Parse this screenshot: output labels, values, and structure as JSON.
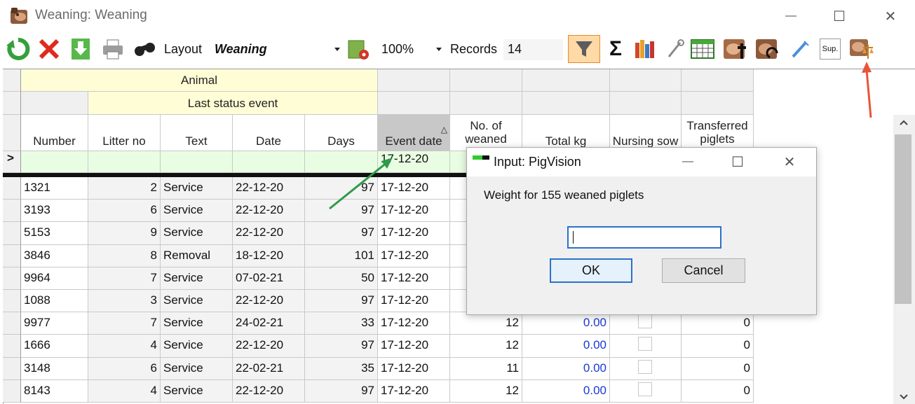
{
  "window": {
    "title": "Weaning: Weaning",
    "minimize_glyph": "—",
    "maximize_glyph": "☐",
    "close_glyph": "✕"
  },
  "toolbar": {
    "layout_label": "Layout",
    "layout_value": "Weaning",
    "zoom_value": "100%",
    "records_label": "Records",
    "records_value": "14",
    "sigma": "Σ",
    "sup_label": "Sup."
  },
  "grid": {
    "group_headers": {
      "animal": "Animal",
      "last_status_event": "Last status event"
    },
    "columns": {
      "number": "Number",
      "litter_no": "Litter no",
      "text": "Text",
      "date": "Date",
      "days": "Days",
      "event_date": "Event date",
      "no_of_weaned": "No. of weaned",
      "total_kg": "Total kg",
      "nursing_sow": "Nursing sow",
      "transferred_piglets": "Transferred piglets"
    },
    "sort_indicator": "△",
    "current_row_marker": ">",
    "new_row": {
      "event_date": "17-12-20"
    },
    "rows": [
      {
        "number": "1321",
        "litter": "2",
        "text": "Service",
        "date": "22-12-20",
        "days": "97",
        "event_date": "17-12-20",
        "weaned": "",
        "kg": "",
        "transferred": ""
      },
      {
        "number": "3193",
        "litter": "6",
        "text": "Service",
        "date": "22-12-20",
        "days": "97",
        "event_date": "17-12-20",
        "weaned": "",
        "kg": "",
        "transferred": ""
      },
      {
        "number": "5153",
        "litter": "9",
        "text": "Service",
        "date": "22-12-20",
        "days": "97",
        "event_date": "17-12-20",
        "weaned": "",
        "kg": "",
        "transferred": ""
      },
      {
        "number": "3846",
        "litter": "8",
        "text": "Removal",
        "date": "18-12-20",
        "days": "101",
        "event_date": "17-12-20",
        "weaned": "",
        "kg": "",
        "transferred": ""
      },
      {
        "number": "9964",
        "litter": "7",
        "text": "Service",
        "date": "07-02-21",
        "days": "50",
        "event_date": "17-12-20",
        "weaned": "",
        "kg": "",
        "transferred": ""
      },
      {
        "number": "1088",
        "litter": "3",
        "text": "Service",
        "date": "22-12-20",
        "days": "97",
        "event_date": "17-12-20",
        "weaned": "",
        "kg": "",
        "transferred": ""
      },
      {
        "number": "9977",
        "litter": "7",
        "text": "Service",
        "date": "24-02-21",
        "days": "33",
        "event_date": "17-12-20",
        "weaned": "12",
        "kg": "0.00",
        "transferred": "0"
      },
      {
        "number": "1666",
        "litter": "4",
        "text": "Service",
        "date": "22-12-20",
        "days": "97",
        "event_date": "17-12-20",
        "weaned": "12",
        "kg": "0.00",
        "transferred": "0"
      },
      {
        "number": "3148",
        "litter": "6",
        "text": "Service",
        "date": "22-02-21",
        "days": "35",
        "event_date": "17-12-20",
        "weaned": "11",
        "kg": "0.00",
        "transferred": "0"
      },
      {
        "number": "8143",
        "litter": "4",
        "text": "Service",
        "date": "22-12-20",
        "days": "97",
        "event_date": "17-12-20",
        "weaned": "12",
        "kg": "0.00",
        "transferred": "0"
      }
    ]
  },
  "dialog": {
    "title": "Input: PigVision",
    "message": "Weight for 155 weaned piglets",
    "input_value": "",
    "ok_label": "OK",
    "cancel_label": "Cancel",
    "minimize_glyph": "—",
    "maximize_glyph": "☐",
    "close_glyph": "✕"
  },
  "colors": {
    "header_yellow": "#fffdd6",
    "new_row_green": "#e9fde3",
    "value_blue": "#1a39d6",
    "focus_blue": "#2c71c9",
    "annotation_red": "#e8543a",
    "annotation_green": "#2e9a4a"
  }
}
